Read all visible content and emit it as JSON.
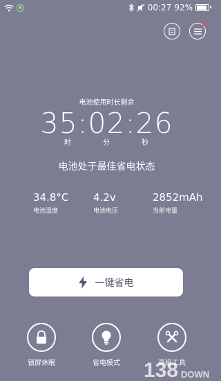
{
  "status_bar": {
    "icons": [
      "wifi-icon",
      "data-ring-icon",
      "bluetooth-icon",
      "muted-icon"
    ],
    "time": "00:27",
    "battery": "92%",
    "battery_fraction": 0.92
  },
  "header": {
    "left_button_icon": "document-icon",
    "right_button_icon": "menu-icon",
    "notification_color": "#ff4a4a"
  },
  "battery_info": {
    "title": "电池使用时长剩余",
    "time_remaining": "35:02:26",
    "unit_hours": "时",
    "unit_minutes": "分",
    "unit_seconds": "秒",
    "state": "电池处于最佳省电状态"
  },
  "stats": [
    {
      "value": "34.8°C",
      "label": "电池温度"
    },
    {
      "value": "4.2v",
      "label": "电池电压"
    },
    {
      "value": "2852mAh",
      "label": "当前电量"
    }
  ],
  "action": {
    "label": "一键省电",
    "icon": "lightning-icon"
  },
  "tools": [
    {
      "label": "锁屏休眠",
      "icon": "lock-icon"
    },
    {
      "label": "省电模式",
      "icon": "lightbulb-icon"
    },
    {
      "label": "高级工具",
      "icon": "wrench-icon"
    }
  ],
  "watermark": {
    "number": "138",
    "text": "DOWN"
  },
  "colors": {
    "background": "#7c7d93",
    "button_bg": "#ffffff",
    "button_text": "#585a6f"
  }
}
